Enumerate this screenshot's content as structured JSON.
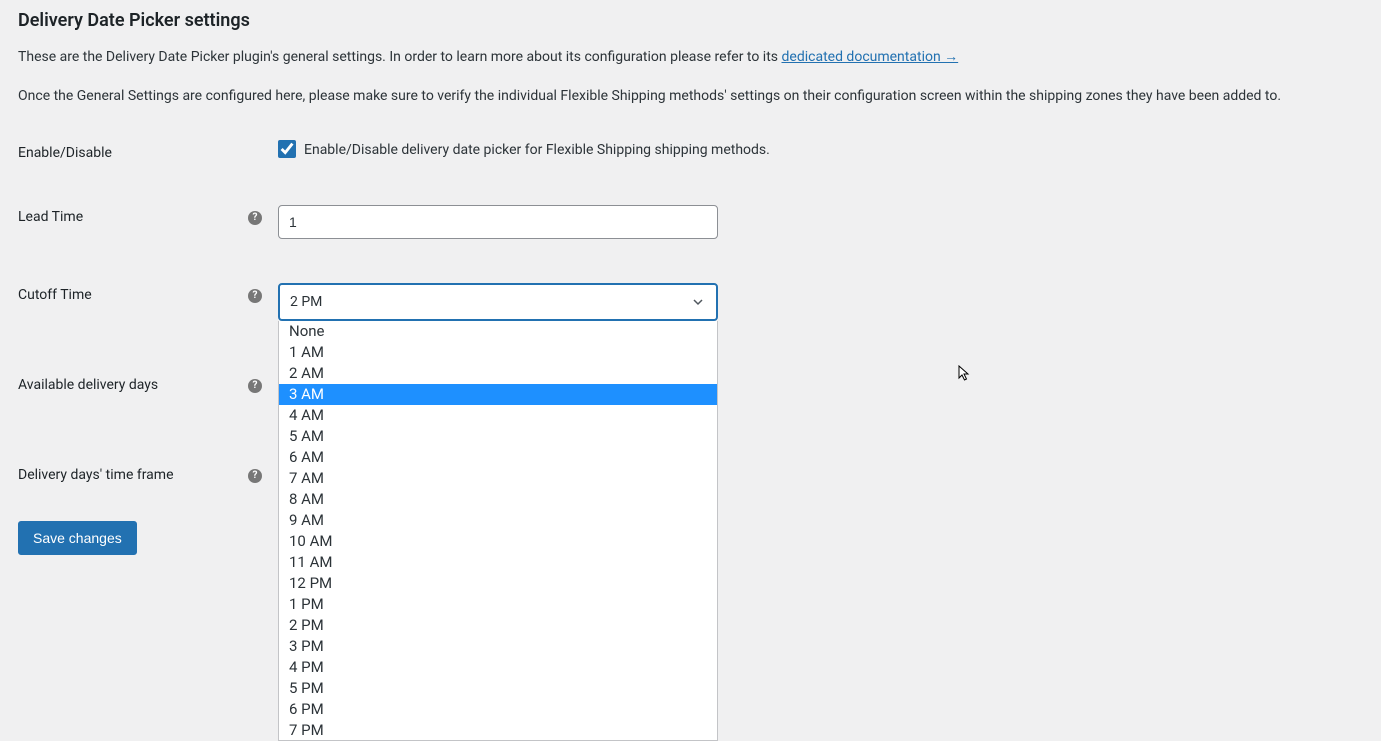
{
  "header": {
    "title": "Delivery Date Picker settings",
    "desc1_pre": "These are the Delivery Date Picker plugin's general settings. In order to learn more about its configuration please refer to its ",
    "doc_link_text": "dedicated documentation →",
    "desc2": "Once the General Settings are configured here, please make sure to verify the individual Flexible Shipping methods' settings on their configuration screen within the shipping zones they have been added to."
  },
  "fields": {
    "enable": {
      "label": "Enable/Disable",
      "checked": true,
      "description": "Enable/Disable delivery date picker for Flexible Shipping shipping methods."
    },
    "lead_time": {
      "label": "Lead Time",
      "value": "1"
    },
    "cutoff_time": {
      "label": "Cutoff Time",
      "selected": "2 PM",
      "highlighted_option": "3 AM",
      "options": [
        "None",
        "1 AM",
        "2 AM",
        "3 AM",
        "4 AM",
        "5 AM",
        "6 AM",
        "7 AM",
        "8 AM",
        "9 AM",
        "10 AM",
        "11 AM",
        "12 PM",
        "1 PM",
        "2 PM",
        "3 PM",
        "4 PM",
        "5 PM",
        "6 PM",
        "7 PM"
      ]
    },
    "available_days": {
      "label": "Available delivery days"
    },
    "delivery_frame": {
      "label": "Delivery days' time frame"
    }
  },
  "buttons": {
    "save": "Save changes"
  }
}
